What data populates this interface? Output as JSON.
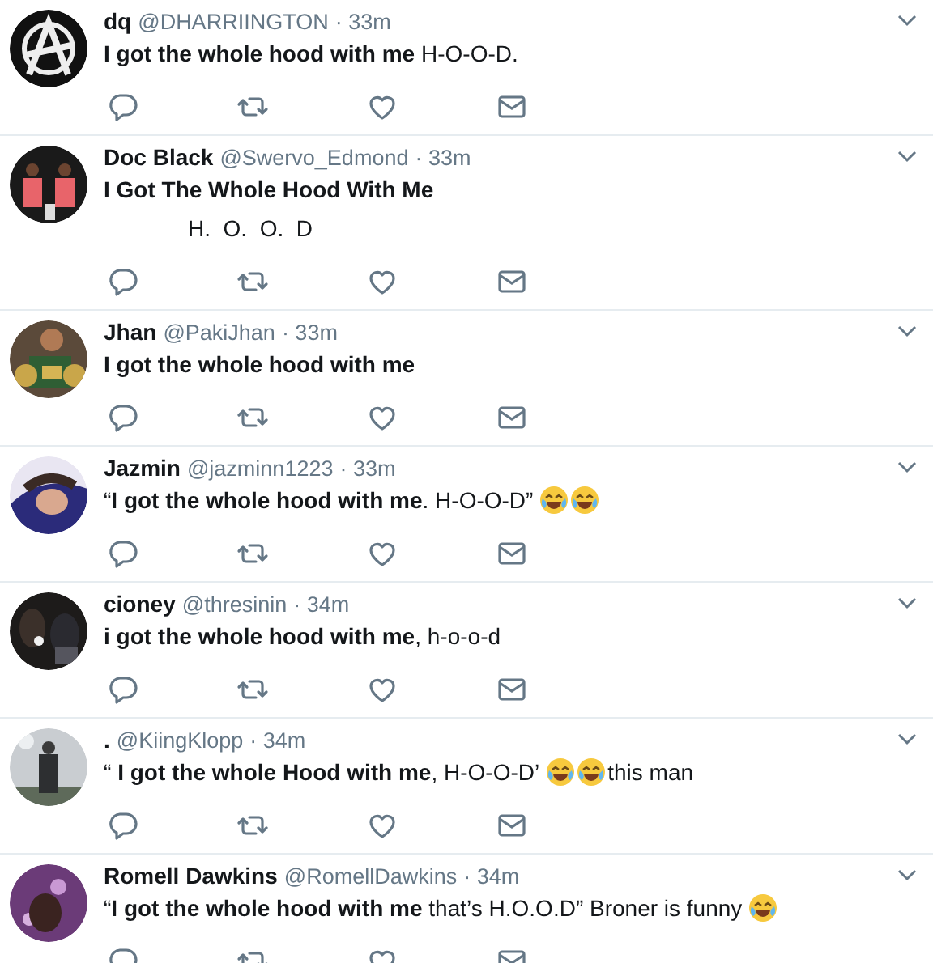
{
  "tweets": [
    {
      "name": "dq",
      "handle": "@DHARRIINGTON",
      "time": "· 33m",
      "lines": [
        [
          {
            "kind": "text",
            "text": "**I got the whole hood with me** H-O-O-D."
          }
        ]
      ]
    },
    {
      "name": "Doc Black",
      "handle": "@Swervo_Edmond",
      "time": "· 33m",
      "lines": [
        [
          {
            "kind": "text",
            "text": "**I Got The Whole Hood With Me**"
          }
        ],
        [
          {
            "kind": "indent"
          },
          {
            "kind": "text",
            "text": "H.  O.  O.  D"
          }
        ]
      ]
    },
    {
      "name": "Jhan",
      "handle": "@PakiJhan",
      "time": "· 33m",
      "lines": [
        [
          {
            "kind": "text",
            "text": "**I got the whole hood with me**"
          }
        ]
      ]
    },
    {
      "name": "Jazmin",
      "handle": "@jazminn1223",
      "time": "· 33m",
      "lines": [
        [
          {
            "kind": "text",
            "text": "“**I got the whole hood with me**. H-O-O-D”"
          },
          {
            "kind": "emoji"
          },
          {
            "kind": "emoji"
          }
        ]
      ]
    },
    {
      "name": "cioney",
      "handle": "@thresinin",
      "time": "· 34m",
      "lines": [
        [
          {
            "kind": "text",
            "text": "**i got the whole hood with me**, h-o-o-d"
          }
        ]
      ]
    },
    {
      "name": ".",
      "handle": "@KiingKlopp",
      "time": "· 34m",
      "lines": [
        [
          {
            "kind": "text",
            "text": "“ **I got the whole Hood with me**, H-O-O-D’"
          },
          {
            "kind": "emoji"
          },
          {
            "kind": "emoji"
          },
          {
            "kind": "text",
            "text": "this man"
          }
        ]
      ]
    },
    {
      "name": "Romell Dawkins",
      "handle": "@RomellDawkins",
      "time": "· 34m",
      "lines": [
        [
          {
            "kind": "text",
            "text": "“**I got the whole hood with me** that’s H.O.O.D” Broner is funny"
          },
          {
            "kind": "emoji"
          }
        ]
      ]
    }
  ]
}
